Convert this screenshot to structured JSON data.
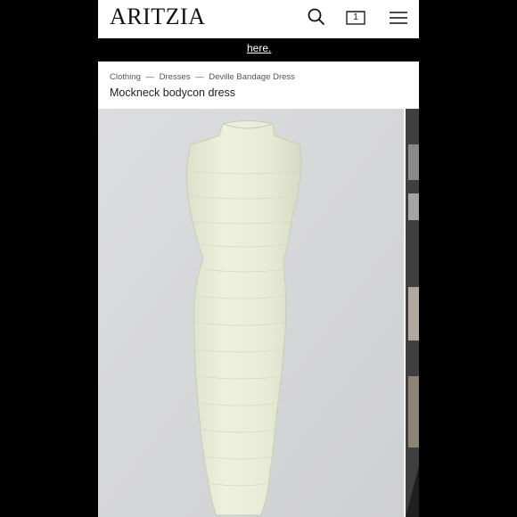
{
  "header": {
    "logo": "ARITZIA",
    "icons": [
      "search-icon",
      "bag-icon",
      "menu-icon"
    ],
    "bag_count": "1"
  },
  "banner": {
    "link_text": "here."
  },
  "breadcrumb": {
    "items": [
      "Clothing",
      "Dresses",
      "Deville Bandage Dress"
    ],
    "separator": "—"
  },
  "product": {
    "title": "Mockneck bodycon dress"
  },
  "colors": {
    "dress": "#e9ecd8",
    "image_bg": "#d8d9db",
    "banner": "#000000"
  }
}
